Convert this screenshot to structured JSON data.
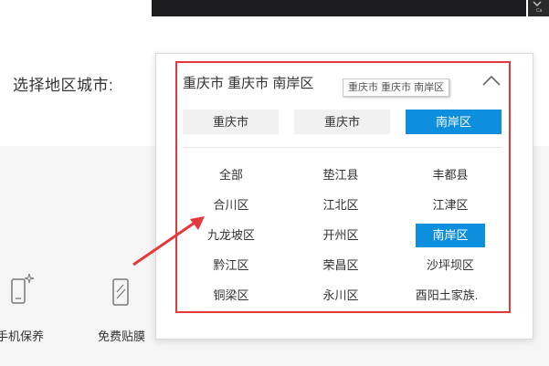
{
  "header": {
    "corner_text": "Ca"
  },
  "region_label": "选择地区城市:",
  "popup": {
    "selected_path": "重庆市 重庆市 南岸区",
    "tooltip": "重庆市 重庆市 南岸区",
    "level_tabs": [
      {
        "label": "重庆市",
        "active": false
      },
      {
        "label": "重庆市",
        "active": false
      },
      {
        "label": "南岸区",
        "active": true
      }
    ],
    "districts": [
      {
        "label": "全部",
        "selected": false
      },
      {
        "label": "垫江县",
        "selected": false
      },
      {
        "label": "丰都县",
        "selected": false
      },
      {
        "label": "合川区",
        "selected": false
      },
      {
        "label": "江北区",
        "selected": false
      },
      {
        "label": "江津区",
        "selected": false
      },
      {
        "label": "九龙坡区",
        "selected": false
      },
      {
        "label": "开州区",
        "selected": false
      },
      {
        "label": "南岸区",
        "selected": true
      },
      {
        "label": "黔江区",
        "selected": false
      },
      {
        "label": "荣昌区",
        "selected": false
      },
      {
        "label": "沙坪坝区",
        "selected": false
      },
      {
        "label": "铜梁区",
        "selected": false
      },
      {
        "label": "永川区",
        "selected": false
      },
      {
        "label": "酉阳土家族.",
        "selected": false
      }
    ]
  },
  "services": [
    {
      "label": "手机保养",
      "icon": "phone-care-icon"
    },
    {
      "label": "免费贴膜",
      "icon": "screen-film-icon"
    }
  ],
  "colors": {
    "accent": "#0d8fde",
    "annotation_red": "#e3393c"
  }
}
